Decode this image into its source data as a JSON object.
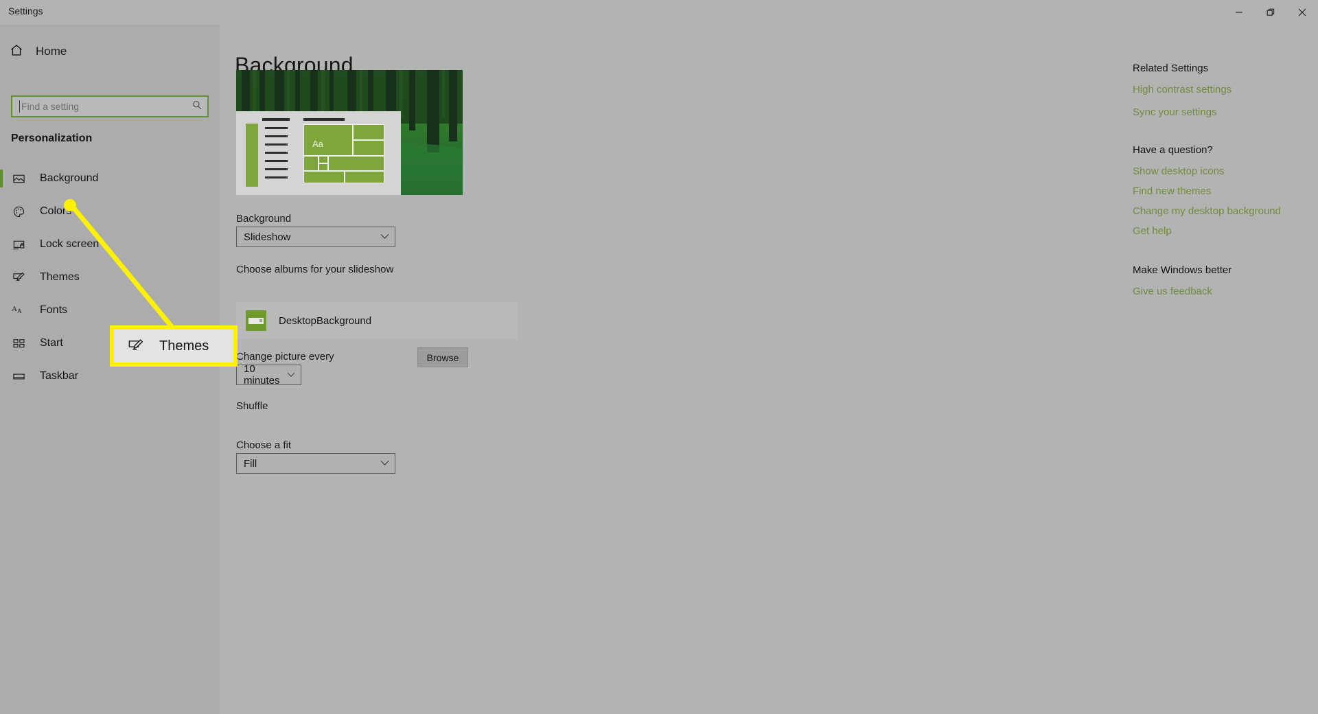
{
  "window": {
    "title": "Settings",
    "controls": [
      {
        "name": "minimize",
        "label": "Minimize"
      },
      {
        "name": "restore",
        "label": "Restore"
      },
      {
        "name": "close",
        "label": "Close"
      }
    ]
  },
  "sidebar": {
    "home_label": "Home",
    "home_icon": "home-icon",
    "search": {
      "placeholder": "Find a setting",
      "value": "",
      "icon": "search-icon"
    },
    "category": "Personalization",
    "items": [
      {
        "label": "Background",
        "icon": "picture-icon",
        "selected": true
      },
      {
        "label": "Colors",
        "icon": "palette-icon",
        "selected": false
      },
      {
        "label": "Lock screen",
        "icon": "lockscreen-icon",
        "selected": false
      },
      {
        "label": "Themes",
        "icon": "themes-icon",
        "selected": false
      },
      {
        "label": "Fonts",
        "icon": "fonts-icon",
        "selected": false
      },
      {
        "label": "Start",
        "icon": "start-icon",
        "selected": false
      },
      {
        "label": "Taskbar",
        "icon": "taskbar-icon",
        "selected": false
      }
    ]
  },
  "main": {
    "page_title": "Background",
    "preview": {
      "tile_text": "Aa",
      "description": "Forest path desktop preview with Start menu mockup"
    },
    "background": {
      "label": "Background",
      "value": "Slideshow"
    },
    "albums": {
      "label": "Choose albums for your slideshow",
      "folder_name": "DesktopBackground",
      "browse_label": "Browse"
    },
    "interval": {
      "label": "Change picture every",
      "value": "10 minutes"
    },
    "shuffle": {
      "label": "Shuffle",
      "state": "Off",
      "on": false
    },
    "fit": {
      "label": "Choose a fit",
      "value": "Fill"
    }
  },
  "rail": {
    "groups": [
      {
        "heading": "Related Settings",
        "links": [
          "High contrast settings",
          "Sync your settings"
        ]
      },
      {
        "heading": "Have a question?",
        "links": [
          "Show desktop icons",
          "Find new themes",
          "Change my desktop background",
          "Get help"
        ]
      },
      {
        "heading": "Make Windows better",
        "links": [
          "Give us feedback"
        ]
      }
    ]
  },
  "annotation": {
    "callout_label": "Themes",
    "callout_icon": "themes-icon",
    "highlight_color": "#fff200",
    "accent_color": "#6f8c3e"
  }
}
